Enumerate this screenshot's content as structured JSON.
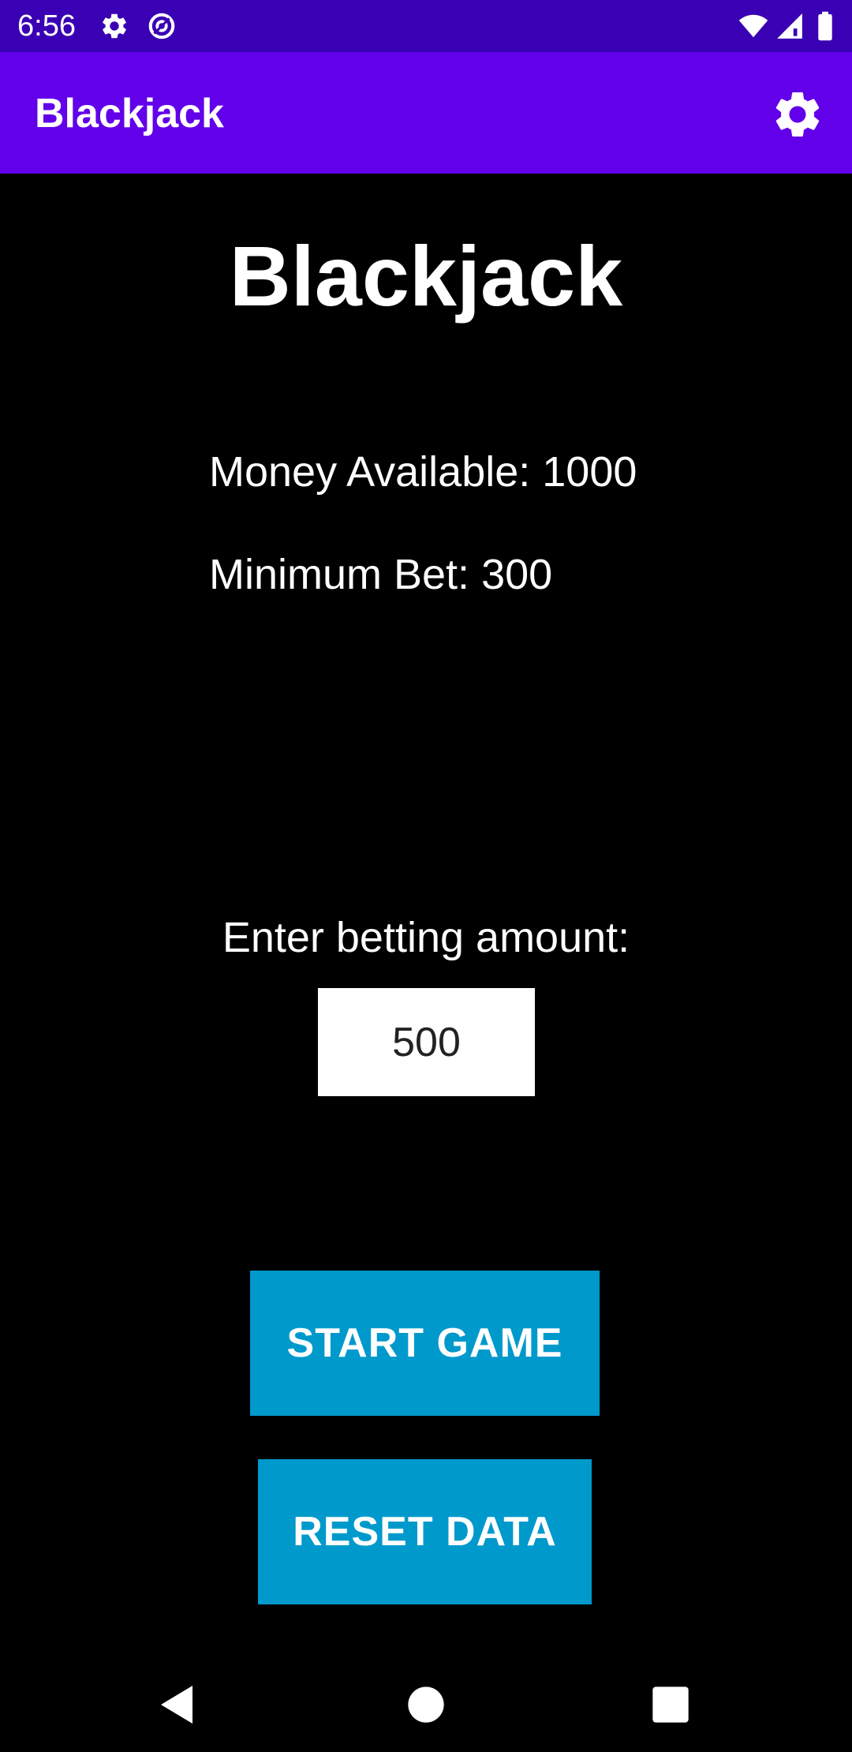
{
  "status_bar": {
    "time": "6:56",
    "left_icons": [
      "gear-icon",
      "at-sign-icon"
    ],
    "right_icons": [
      "wifi-icon",
      "cell-signal-icon",
      "battery-icon"
    ],
    "background": "#3a00b3"
  },
  "app_bar": {
    "title": "Blackjack",
    "settings_icon": "gear-icon",
    "background": "#6200ea"
  },
  "main": {
    "headline": "Blackjack",
    "money_available": "Money Available: 1000",
    "minimum_bet": "Minimum Bet: 300",
    "bet_label": "Enter betting amount:",
    "bet_value": "500",
    "start_button": "START GAME",
    "reset_button": "RESET DATA",
    "button_color": "#0099cc"
  },
  "nav_bar": {
    "icons": [
      "back-icon",
      "home-icon",
      "recents-icon"
    ]
  }
}
